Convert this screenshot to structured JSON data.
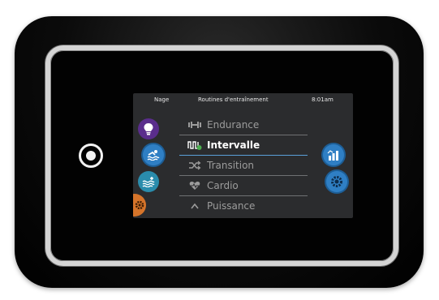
{
  "status": {
    "left": "Nage",
    "title": "Routines d'entraînement",
    "time": "8:01am"
  },
  "routines": [
    {
      "label": "Endurance",
      "icon": "dumbbell-icon",
      "selected": false
    },
    {
      "label": "Intervalle",
      "icon": "interval-wave-icon",
      "selected": true
    },
    {
      "label": "Transition",
      "icon": "shuffle-icon",
      "selected": false
    },
    {
      "label": "Cardio",
      "icon": "heart-pulse-icon",
      "selected": false
    },
    {
      "label": "Puissance",
      "icon": "chevron-up-icon",
      "selected": false
    }
  ],
  "left_icons": [
    "light-bulb-icon",
    "swimmer-icon",
    "water-waves-icon",
    "orange-gear-icon"
  ],
  "right_icons": [
    "stats-chart-icon",
    "settings-gear-icon"
  ],
  "colors": {
    "screen_bg": "#2b2c2e",
    "accent_blue": "#2f7fc4",
    "purple": "#5a2d8c",
    "teal": "#2a8cac",
    "orange": "#d5742a"
  }
}
